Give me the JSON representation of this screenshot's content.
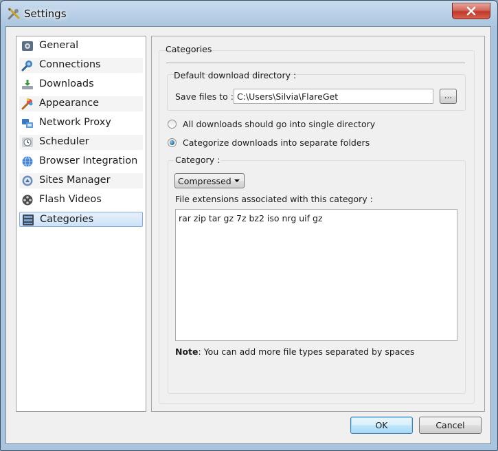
{
  "window": {
    "title": "Settings"
  },
  "sidebar": {
    "items": [
      {
        "label": "General",
        "icon": "gear-icon"
      },
      {
        "label": "Connections",
        "icon": "connections-icon"
      },
      {
        "label": "Downloads",
        "icon": "download-icon"
      },
      {
        "label": "Appearance",
        "icon": "paint-brush-icon"
      },
      {
        "label": "Network Proxy",
        "icon": "network-icon"
      },
      {
        "label": "Scheduler",
        "icon": "clock-icon"
      },
      {
        "label": "Browser Integration",
        "icon": "globe-icon"
      },
      {
        "label": "Sites Manager",
        "icon": "sites-icon"
      },
      {
        "label": "Flash Videos",
        "icon": "film-icon"
      },
      {
        "label": "Categories",
        "icon": "categories-icon",
        "selected": true
      }
    ]
  },
  "categories": {
    "title": "Categories",
    "default_dir": {
      "title": "Default download directory :",
      "save_label": "Save files to :",
      "path": "C:\\Users\\Silvia\\FlareGet",
      "browse_label": "..."
    },
    "radio_single": {
      "label": "All downloads should go into single directory",
      "checked": false
    },
    "radio_separate": {
      "label": "Categorize downloads into separate folders",
      "checked": true
    },
    "category": {
      "title": "Category :",
      "selected": "Compressed",
      "extensions_label": "File extensions associated with this category :",
      "extensions": "rar zip tar gz 7z bz2 iso nrg uif gz",
      "note_bold": "Note",
      "note_text": ": You can add more file types separated by spaces"
    }
  },
  "buttons": {
    "ok": "OK",
    "cancel": "Cancel"
  }
}
